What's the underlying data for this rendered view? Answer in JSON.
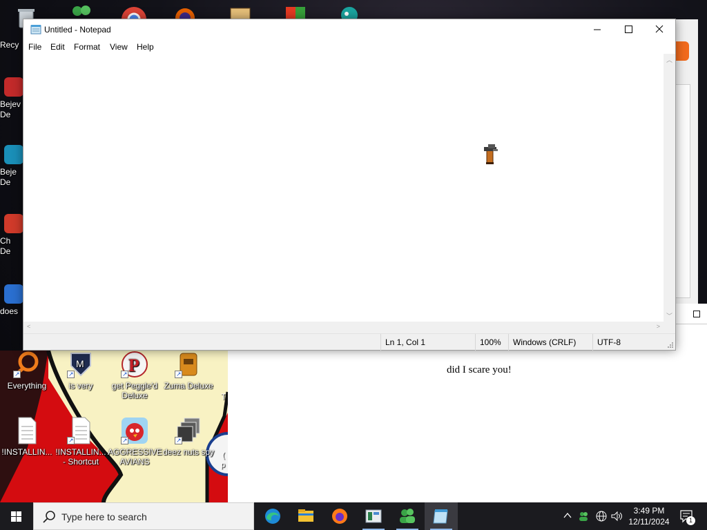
{
  "desktop": {
    "left_column_labels": [
      "Recy",
      "Bejev\nDe",
      "Beje\nDe",
      "Ch\nDe",
      "does"
    ],
    "icons": [
      {
        "label": "Everything"
      },
      {
        "label": "is very"
      },
      {
        "label": "get Peggle'd Deluxe"
      },
      {
        "label": "Zuma Deluxe"
      },
      {
        "label": "!INSTALLIN..."
      },
      {
        "label": "!INSTALLIN... - Shortcut"
      },
      {
        "label": "AGGRESSIVE AVIANS"
      },
      {
        "label": "deez nuts spy"
      }
    ],
    "partial_labels": [
      "T",
      "(",
      "p"
    ]
  },
  "background_page": {
    "message": "did I scare you!"
  },
  "notepad": {
    "title": "Untitled - Notepad",
    "menu": [
      "File",
      "Edit",
      "Format",
      "View",
      "Help"
    ],
    "content": "",
    "status": {
      "position": "Ln 1, Col 1",
      "zoom": "100%",
      "line_ending": "Windows (CRLF)",
      "encoding": "UTF-8"
    }
  },
  "taskbar": {
    "search_placeholder": "Type here to search",
    "apps": [
      "edge-icon",
      "file-explorer-icon",
      "firefox-icon",
      "app-icon",
      "people-icon",
      "notepad-icon"
    ],
    "time": "3:49 PM",
    "date": "12/11/2024",
    "notification_count": "1"
  }
}
